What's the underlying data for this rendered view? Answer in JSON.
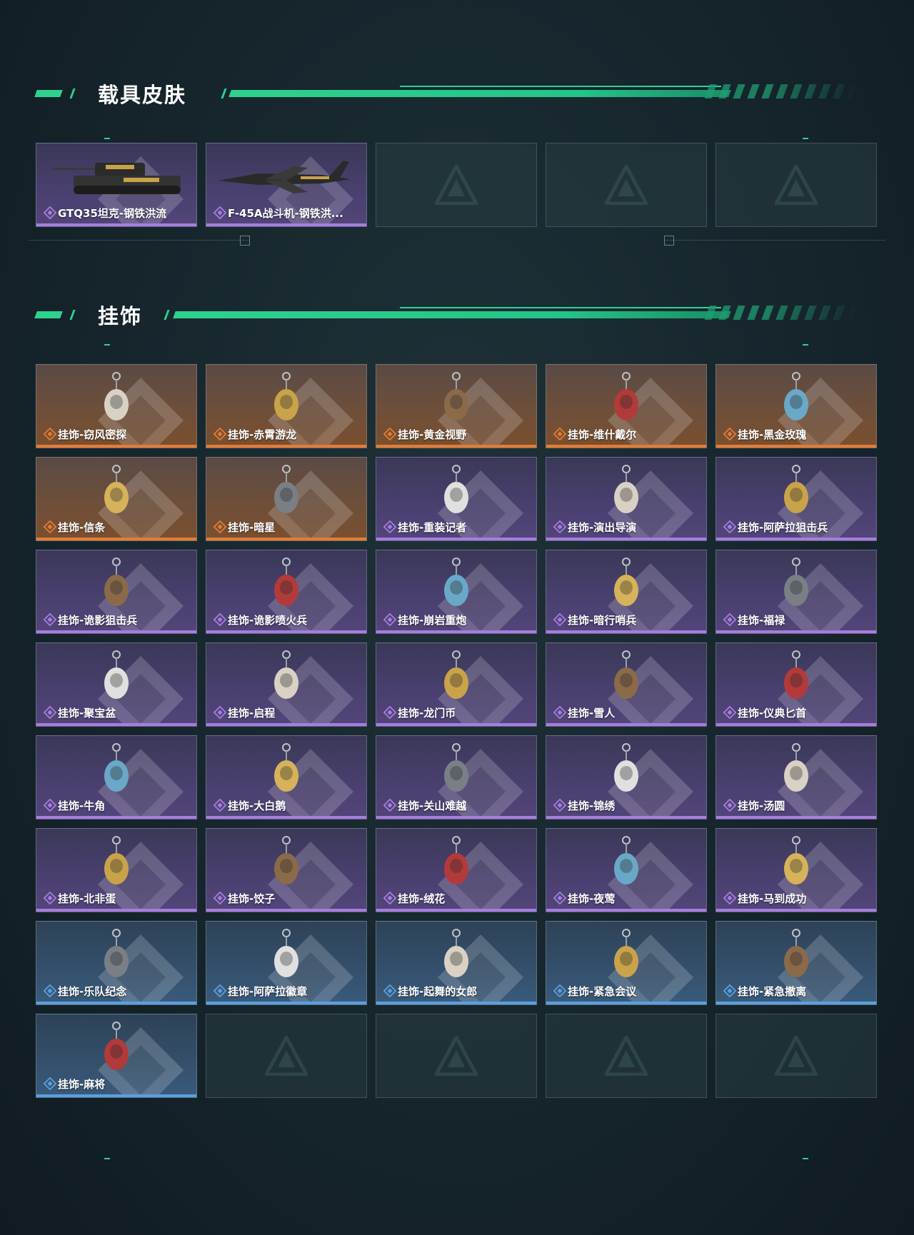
{
  "sections": {
    "vehicle_skins": {
      "title": "载具皮肤",
      "items": [
        {
          "label": "GTQ35坦克-钢铁洪流",
          "rarity": "purple",
          "art": "tank"
        },
        {
          "label": "F-45A战斗机-钢铁洪...",
          "rarity": "purple",
          "art": "jet"
        }
      ],
      "empty_slots": 3
    },
    "charms": {
      "title": "挂饰",
      "items": [
        {
          "label": "挂饰-窃风密探",
          "rarity": "orange"
        },
        {
          "label": "挂饰-赤霄游龙",
          "rarity": "orange"
        },
        {
          "label": "挂饰-黄金视野",
          "rarity": "orange"
        },
        {
          "label": "挂饰-维什戴尔",
          "rarity": "orange"
        },
        {
          "label": "挂饰-黑金玫瑰",
          "rarity": "orange"
        },
        {
          "label": "挂饰-信条",
          "rarity": "orange"
        },
        {
          "label": "挂饰-暗星",
          "rarity": "orange"
        },
        {
          "label": "挂饰-重装记者",
          "rarity": "purple"
        },
        {
          "label": "挂饰-演出导演",
          "rarity": "purple"
        },
        {
          "label": "挂饰-阿萨拉狙击兵",
          "rarity": "purple"
        },
        {
          "label": "挂饰-诡影狙击兵",
          "rarity": "purple"
        },
        {
          "label": "挂饰-诡影喷火兵",
          "rarity": "purple"
        },
        {
          "label": "挂饰-崩岩重炮",
          "rarity": "purple"
        },
        {
          "label": "挂饰-暗行哨兵",
          "rarity": "purple"
        },
        {
          "label": "挂饰-福禄",
          "rarity": "purple"
        },
        {
          "label": "挂饰-聚宝盆",
          "rarity": "purple"
        },
        {
          "label": "挂饰-启程",
          "rarity": "purple"
        },
        {
          "label": "挂饰-龙门币",
          "rarity": "purple"
        },
        {
          "label": "挂饰-雪人",
          "rarity": "purple"
        },
        {
          "label": "挂饰-仪典匕首",
          "rarity": "purple"
        },
        {
          "label": "挂饰-牛角",
          "rarity": "purple"
        },
        {
          "label": "挂饰-大白鹅",
          "rarity": "purple"
        },
        {
          "label": "挂饰-关山难越",
          "rarity": "purple"
        },
        {
          "label": "挂饰-锦绣",
          "rarity": "purple"
        },
        {
          "label": "挂饰-汤圆",
          "rarity": "purple"
        },
        {
          "label": "挂饰-北非蛋",
          "rarity": "purple"
        },
        {
          "label": "挂饰-饺子",
          "rarity": "purple"
        },
        {
          "label": "挂饰-绒花",
          "rarity": "purple"
        },
        {
          "label": "挂饰-夜莺",
          "rarity": "purple"
        },
        {
          "label": "挂饰-马到成功",
          "rarity": "purple"
        },
        {
          "label": "挂饰-乐队纪念",
          "rarity": "blue"
        },
        {
          "label": "挂饰-阿萨拉徽章",
          "rarity": "blue"
        },
        {
          "label": "挂饰-起舞的女郎",
          "rarity": "blue"
        },
        {
          "label": "挂饰-紧急会议",
          "rarity": "blue"
        },
        {
          "label": "挂饰-紧急撤离",
          "rarity": "blue"
        },
        {
          "label": "挂饰-麻将",
          "rarity": "blue"
        }
      ],
      "empty_slots": 4
    }
  },
  "colors": {
    "accent": "#2fd18e",
    "orange": "#e57b34",
    "purple": "#a77de0",
    "blue": "#5aa0e0"
  }
}
